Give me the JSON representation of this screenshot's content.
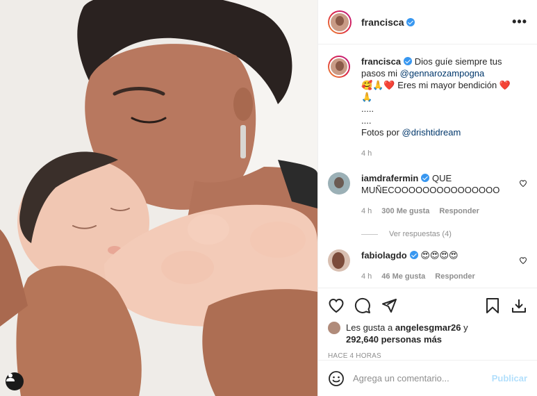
{
  "post": {
    "username": "francisca",
    "more_label": "•••"
  },
  "caption": {
    "username": "francisca",
    "text_1": "Dios guíe siempre tus pasos mi",
    "mention_1": "@gennarozampogna",
    "line_2_emoji": "🥰🙏❤️",
    "line_2_text": "Eres mi mayor bendición",
    "line_2_end": "❤️",
    "line_3": "🙏",
    "dots_1": ".....",
    "dots_2": "....",
    "photo_credit_prefix": "Fotos por",
    "photo_credit_mention": "@drishtidream",
    "time": "4 h"
  },
  "comments": [
    {
      "username": "iamdrafermin",
      "text": "QUE MUÑECOOOOOOOOOOOOOOO",
      "time": "4 h",
      "likes": "300 Me gusta",
      "reply": "Responder",
      "view_replies": "Ver respuestas (4)"
    },
    {
      "username": "fabiolagdo",
      "text": "😍😍😍😍",
      "time": "4 h",
      "likes": "46 Me gusta",
      "reply": "Responder"
    }
  ],
  "likes": {
    "prefix": "Les gusta a",
    "user": "angelesgmar26",
    "suffix": "y",
    "count": "292,640 personas más"
  },
  "timestamp": "HACE 4 HORAS",
  "comment_box": {
    "placeholder": "Agrega un comentario...",
    "publish_label": "Publicar"
  },
  "colors": {
    "verified": "#3897f0",
    "link": "#00376b",
    "muted": "#8e8e8e",
    "publish_disabled": "#b2dffc"
  }
}
